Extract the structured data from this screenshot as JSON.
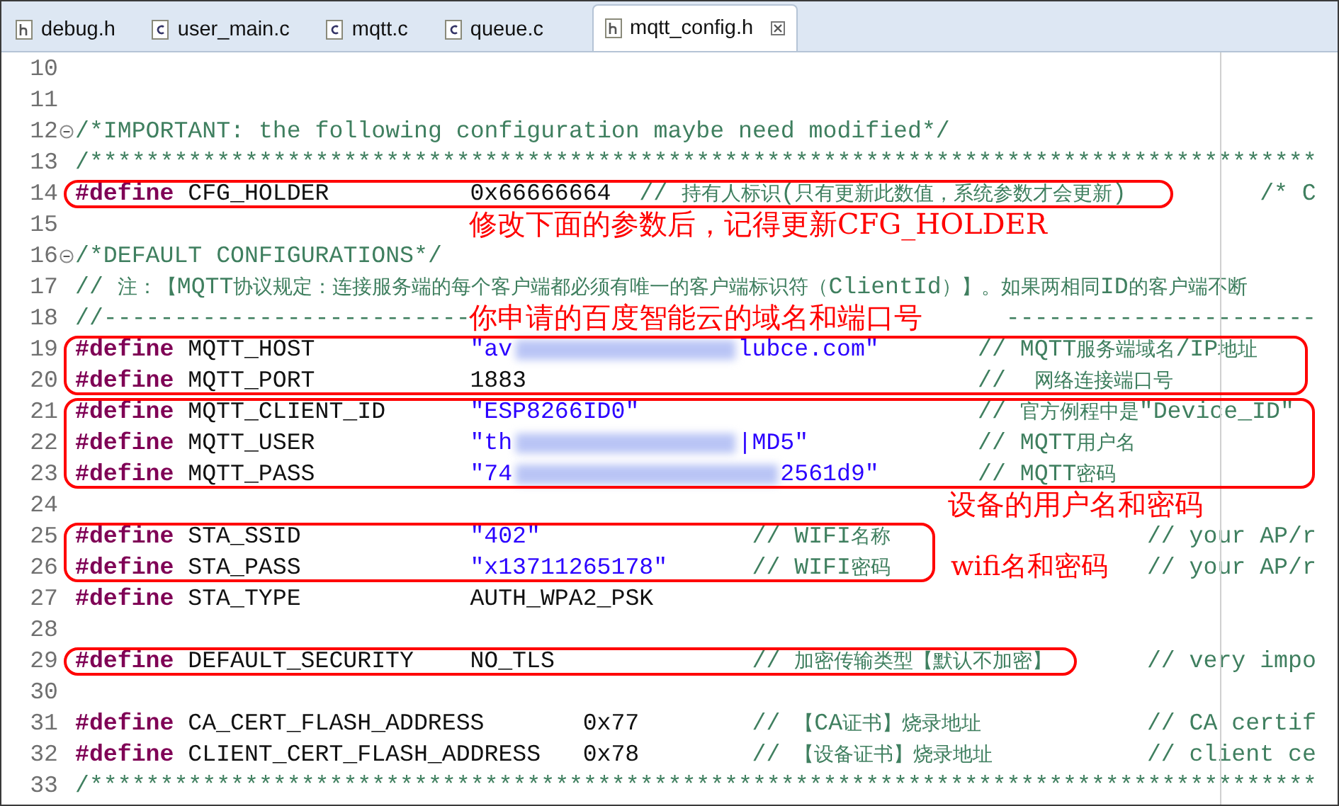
{
  "tabs": [
    {
      "label": "debug.h",
      "kind": "header",
      "selected": false
    },
    {
      "label": "user_main.c",
      "kind": "source",
      "selected": false
    },
    {
      "label": "mqtt.c",
      "kind": "source",
      "selected": false
    },
    {
      "label": "queue.c",
      "kind": "source",
      "selected": false
    },
    {
      "label": "mqtt_config.h",
      "kind": "header",
      "selected": true
    }
  ],
  "lines": [
    {
      "number": "10",
      "foldable": false,
      "boxed": false
    },
    {
      "number": "11",
      "foldable": false,
      "boxed": false
    },
    {
      "number": "12",
      "foldable": true,
      "boxed": false,
      "segments": [
        {
          "kind": "comment",
          "text": "/*IMPORTANT: the following configuration maybe need modified*/"
        }
      ]
    },
    {
      "number": "13",
      "foldable": false,
      "boxed": false,
      "segments": [
        {
          "kind": "comment",
          "text": "/***************************************************************************************"
        }
      ]
    },
    {
      "number": "14",
      "foldable": false,
      "boxed": true,
      "segments": [
        {
          "kind": "keyword",
          "text": "#define"
        },
        {
          "kind": "plain",
          "text": "CFG_HOLDER"
        },
        {
          "kind": "plain",
          "text": "0x66666664"
        },
        {
          "kind": "comment",
          "text": "// 持有人标识(只有更新此数值，系统参数才会更新)"
        },
        {
          "kind": "comment",
          "text": "/* C"
        }
      ]
    },
    {
      "number": "15",
      "foldable": false,
      "boxed": false
    },
    {
      "number": "16",
      "foldable": true,
      "boxed": false,
      "segments": [
        {
          "kind": "comment",
          "text": "/*DEFAULT CONFIGURATIONS*/"
        }
      ]
    },
    {
      "number": "17",
      "foldable": false,
      "boxed": false,
      "segments": [
        {
          "kind": "comment",
          "text": "// 注：【MQTT协议规定：连接服务端的每个客户端都必须有唯一的客户端标识符（ClientId）】。如果两相同ID的客户端不断"
        }
      ]
    },
    {
      "number": "18",
      "foldable": false,
      "boxed": false,
      "segments": [
        {
          "kind": "comment",
          "text": "//--------------------------"
        },
        {
          "kind": "comment",
          "text": "----------------------"
        }
      ]
    },
    {
      "number": "19",
      "foldable": false,
      "boxed": true,
      "segments": [
        {
          "kind": "keyword",
          "text": "#define"
        },
        {
          "kind": "plain",
          "text": "MQTT_HOST"
        },
        {
          "kind": "string",
          "text": "\"av"
        },
        {
          "kind": "redacted"
        },
        {
          "kind": "string",
          "text": "lubce.com\""
        },
        {
          "kind": "comment",
          "text": "// MQTT服务端域名/IP地址"
        }
      ]
    },
    {
      "number": "20",
      "foldable": false,
      "boxed": true,
      "segments": [
        {
          "kind": "keyword",
          "text": "#define"
        },
        {
          "kind": "plain",
          "text": "MQTT_PORT"
        },
        {
          "kind": "plain",
          "text": "1883"
        },
        {
          "kind": "comment",
          "text": "//  网络连接端口号"
        }
      ]
    },
    {
      "number": "21",
      "foldable": false,
      "boxed": true,
      "segments": [
        {
          "kind": "keyword",
          "text": "#define"
        },
        {
          "kind": "plain",
          "text": "MQTT_CLIENT_ID"
        },
        {
          "kind": "string",
          "text": "\"ESP8266ID0\""
        },
        {
          "kind": "comment",
          "text": "// 官方例程中是\"Device_ID\""
        }
      ]
    },
    {
      "number": "22",
      "foldable": false,
      "boxed": true,
      "segments": [
        {
          "kind": "keyword",
          "text": "#define"
        },
        {
          "kind": "plain",
          "text": "MQTT_USER"
        },
        {
          "kind": "string",
          "text": "\"th"
        },
        {
          "kind": "redacted"
        },
        {
          "kind": "string",
          "text": "|MD5\""
        },
        {
          "kind": "comment",
          "text": "// MQTT用户名"
        }
      ]
    },
    {
      "number": "23",
      "foldable": false,
      "boxed": true,
      "segments": [
        {
          "kind": "keyword",
          "text": "#define"
        },
        {
          "kind": "plain",
          "text": "MQTT_PASS"
        },
        {
          "kind": "string",
          "text": "\"74"
        },
        {
          "kind": "redacted"
        },
        {
          "kind": "string",
          "text": "2561d9\""
        },
        {
          "kind": "comment",
          "text": "// MQTT密码"
        }
      ]
    },
    {
      "number": "24",
      "foldable": false,
      "boxed": false
    },
    {
      "number": "25",
      "foldable": false,
      "boxed": true,
      "segments": [
        {
          "kind": "keyword",
          "text": "#define"
        },
        {
          "kind": "plain",
          "text": "STA_SSID"
        },
        {
          "kind": "string",
          "text": "\"402\""
        },
        {
          "kind": "comment",
          "text": "// WIFI名称"
        },
        {
          "kind": "comment",
          "text": "// your AP/r"
        }
      ]
    },
    {
      "number": "26",
      "foldable": false,
      "boxed": true,
      "segments": [
        {
          "kind": "keyword",
          "text": "#define"
        },
        {
          "kind": "plain",
          "text": "STA_PASS"
        },
        {
          "kind": "string",
          "text": "\"x13711265178\""
        },
        {
          "kind": "comment",
          "text": "// WIFI密码"
        },
        {
          "kind": "comment",
          "text": "// your AP/r"
        }
      ]
    },
    {
      "number": "27",
      "foldable": false,
      "boxed": false,
      "segments": [
        {
          "kind": "keyword",
          "text": "#define"
        },
        {
          "kind": "plain",
          "text": "STA_TYPE"
        },
        {
          "kind": "plain",
          "text": "AUTH_WPA2_PSK"
        }
      ]
    },
    {
      "number": "28",
      "foldable": false,
      "boxed": false
    },
    {
      "number": "29",
      "foldable": false,
      "boxed": true,
      "segments": [
        {
          "kind": "keyword",
          "text": "#define"
        },
        {
          "kind": "plain",
          "text": "DEFAULT_SECURITY"
        },
        {
          "kind": "plain",
          "text": "NO_TLS"
        },
        {
          "kind": "comment",
          "text": "// 加密传输类型【默认不加密】"
        },
        {
          "kind": "comment",
          "text": "// very impo"
        }
      ]
    },
    {
      "number": "30",
      "foldable": false,
      "boxed": false
    },
    {
      "number": "31",
      "foldable": false,
      "boxed": false,
      "segments": [
        {
          "kind": "keyword",
          "text": "#define"
        },
        {
          "kind": "plain",
          "text": "CA_CERT_FLASH_ADDRESS"
        },
        {
          "kind": "plain",
          "text": "0x77"
        },
        {
          "kind": "comment",
          "text": "// 【CA证书】烧录地址"
        },
        {
          "kind": "comment",
          "text": "// CA certif"
        }
      ]
    },
    {
      "number": "32",
      "foldable": false,
      "boxed": false,
      "segments": [
        {
          "kind": "keyword",
          "text": "#define"
        },
        {
          "kind": "plain",
          "text": "CLIENT_CERT_FLASH_ADDRESS"
        },
        {
          "kind": "plain",
          "text": "0x78"
        },
        {
          "kind": "comment",
          "text": "// 【设备证书】烧录地址"
        },
        {
          "kind": "comment",
          "text": "// client ce"
        }
      ]
    },
    {
      "number": "33",
      "foldable": false,
      "boxed": false,
      "segments": [
        {
          "kind": "comment",
          "text": "/***************************************************************************************"
        }
      ]
    }
  ],
  "notes": [
    "修改下面的参数后，记得更新CFG_HOLDER",
    "你申请的百度智能云的域名和端口号",
    "设备的用户名和密码",
    "wifi名和密码"
  ]
}
